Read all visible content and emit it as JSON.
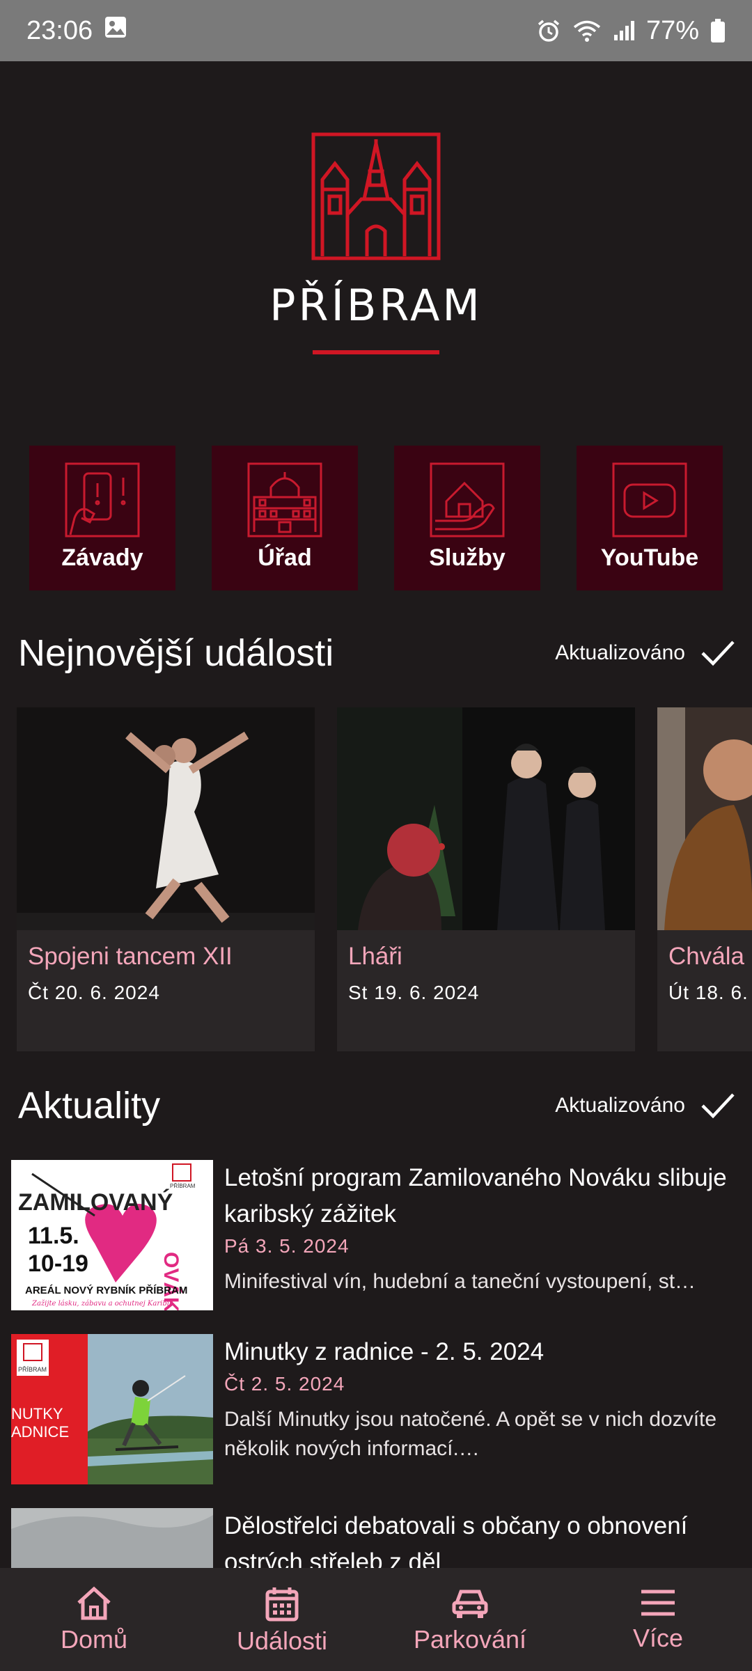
{
  "status_bar": {
    "time": "23:06",
    "battery": "77%"
  },
  "logo": {
    "city_name": "PŘÍBRAM",
    "accent_color": "#d01624"
  },
  "tiles": [
    {
      "label": "Závady",
      "icon": "report-issue-icon"
    },
    {
      "label": "Úřad",
      "icon": "town-hall-icon"
    },
    {
      "label": "Služby",
      "icon": "services-icon"
    },
    {
      "label": "YouTube",
      "icon": "youtube-icon"
    }
  ],
  "events_section": {
    "title": "Nejnovější události",
    "status": "Aktualizováno",
    "items": [
      {
        "title": "Spojeni tancem XII",
        "date": "Čt 20. 6. 2024"
      },
      {
        "title": "Lháři",
        "date": "St 19. 6. 2024"
      },
      {
        "title": "Chvála",
        "date": "Út 18. 6."
      }
    ]
  },
  "news_section": {
    "title": "Aktuality",
    "status": "Aktualizováno",
    "items": [
      {
        "title": "Letošní program Zamilovaného Nováku slibuje karibský zážitek",
        "date": "Pá 3. 5. 2024",
        "description": "Minifestival vín, hudební a taneční vystoupení, st…",
        "thumb": {
          "word1": "ZAMILOVANÝ",
          "word2": "OVÁK",
          "date_line1": "11.5.",
          "date_line2": "10-19",
          "venue": "AREÁL NOVÝ RYBNÍK PŘÍBRAM",
          "tagline": "Zažijte lásku, zábavu a ochutnej Karibik",
          "badge": "PŘÍBRAM"
        }
      },
      {
        "title": "Minutky z radnice - 2. 5. 2024",
        "date": "Čt 2. 5. 2024",
        "description": "Další Minutky jsou natočené. A opět se v nich dozvíte několik nových informací.…",
        "thumb": {
          "line1": "NUTKY",
          "line2": "ADNICE",
          "badge": "PŘÍBRAM"
        }
      },
      {
        "title": "Dělostřelci debatovali s občany o obnovení ostrých střeleb z děl",
        "date": "",
        "description": ""
      }
    ]
  },
  "bottom_nav": [
    {
      "label": "Domů",
      "icon": "home-icon"
    },
    {
      "label": "Události",
      "icon": "calendar-icon"
    },
    {
      "label": "Parkování",
      "icon": "car-icon"
    },
    {
      "label": "Více",
      "icon": "menu-icon"
    }
  ],
  "colors": {
    "background": "#1e1a1b",
    "tile": "#3a0312",
    "accent_pink": "#f4a6ba",
    "card": "#2a2627"
  }
}
